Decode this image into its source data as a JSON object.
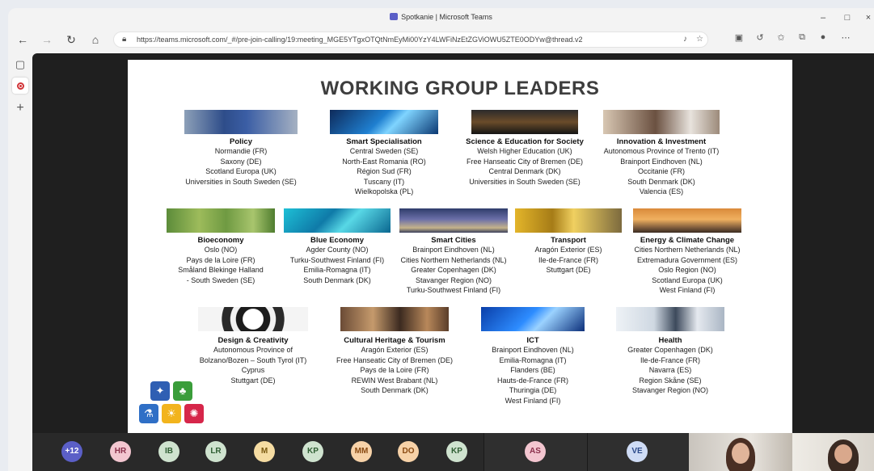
{
  "window": {
    "title": "Spotkanie | Microsoft Teams",
    "controls": {
      "minimize": "–",
      "maximize": "□",
      "close": "×"
    }
  },
  "browser": {
    "url": "https://teams.microsoft.com/_#/pre-join-calling/19:meeting_MGE5YTgxOTQtNmEyMi00YzY4LWFiNzEtZGViOWU5ZTE0ODYw@thread.v2",
    "icons": [
      "back-icon",
      "forward-icon",
      "refresh-icon",
      "home-icon",
      "lock-icon",
      "mic-icon",
      "favorite-icon",
      "extension-icon",
      "refresh-page-icon",
      "favorites-icon",
      "collections-icon",
      "profile-icon",
      "more-icon"
    ]
  },
  "slide": {
    "title": "WORKING GROUP LEADERS",
    "groups": [
      {
        "name": "Policy",
        "members": [
          "Normandie (FR)",
          "Saxony (DE)",
          "Scotland Europa (UK)",
          "Universities in South Sweden (SE)"
        ]
      },
      {
        "name": "Smart Specialisation",
        "members": [
          "Central Sweden (SE)",
          "North-East Romania (RO)",
          "Région Sud (FR)",
          "Tuscany (IT)",
          "Wielkopolska (PL)"
        ]
      },
      {
        "name": "Science & Education for Society",
        "members": [
          "Welsh Higher Education (UK)",
          "Free Hanseatic City of Bremen (DE)",
          "Central Denmark (DK)",
          "Universities in South Sweden (SE)"
        ]
      },
      {
        "name": "Innovation & Investment",
        "members": [
          "Autonomous Province of Trento (IT)",
          "Brainport Eindhoven (NL)",
          "Occitanie (FR)",
          "South Denmark (DK)",
          "Valencia (ES)"
        ]
      },
      {
        "name": "Bioeconomy",
        "members": [
          "Oslo (NO)",
          "Pays de la Loire (FR)",
          "Småland Blekinge Halland",
          "- South Sweden (SE)"
        ]
      },
      {
        "name": "Blue Economy",
        "members": [
          "Agder County (NO)",
          "Turku-Southwest Finland (FI)",
          "Emilia-Romagna (IT)",
          "South Denmark (DK)"
        ]
      },
      {
        "name": "Smart Cities",
        "members": [
          "Brainport Eindhoven (NL)",
          "Cities Northern Netherlands (NL)",
          "Greater Copenhagen (DK)",
          "Stavanger Region (NO)",
          "Turku-Southwest Finland (FI)"
        ]
      },
      {
        "name": "Transport",
        "members": [
          "Aragón Exterior (ES)",
          "Ile-de-France (FR)",
          "Stuttgart (DE)"
        ]
      },
      {
        "name": "Energy & Climate Change",
        "members": [
          "Cities Northern Netherlands (NL)",
          "Extremadura Government (ES)",
          "Oslo Region (NO)",
          "Scotland Europa (UK)",
          "West Finland (FI)"
        ]
      },
      {
        "name": "Design & Creativity",
        "members": [
          "Autonomous Province of",
          "Bolzano/Bozen – South Tyrol (IT)",
          "Cyprus",
          "Stuttgart (DE)"
        ]
      },
      {
        "name": "Cultural Heritage & Tourism",
        "members": [
          "Aragón Exterior (ES)",
          "Free Hanseatic City of Bremen (DE)",
          "Pays de la Loire (FR)",
          "REWIN West Brabant (NL)",
          "South Denmark (DK)"
        ]
      },
      {
        "name": "ICT",
        "members": [
          "Brainport Eindhoven (NL)",
          "Emilia-Romagna (IT)",
          "Flanders (BE)",
          "Hauts-de-France (FR)",
          "Thuringia (DE)",
          "West Finland (FI)"
        ]
      },
      {
        "name": "Health",
        "members": [
          "Greater Copenhagen (DK)",
          "Ile-de-France (FR)",
          "Navarra (ES)",
          "Region Skåne (SE)",
          "Stavanger Region (NO)"
        ]
      }
    ]
  },
  "participants": {
    "overflow": "+12",
    "avatars": [
      {
        "initials": "HR",
        "bg": "#f3c6d0",
        "fg": "#8a2f4a"
      },
      {
        "initials": "IB",
        "bg": "#cfe3cf",
        "fg": "#2f5e33"
      },
      {
        "initials": "LR",
        "bg": "#cfe3cf",
        "fg": "#2f5e33"
      },
      {
        "initials": "M",
        "bg": "#f5dca2",
        "fg": "#7a5a10"
      },
      {
        "initials": "KP",
        "bg": "#cfe3cf",
        "fg": "#2f5e33"
      },
      {
        "initials": "MM",
        "bg": "#f7d2a8",
        "fg": "#8a4a12"
      },
      {
        "initials": "DO",
        "bg": "#f7d2a8",
        "fg": "#8a4a12"
      },
      {
        "initials": "KP",
        "bg": "#cfe3cf",
        "fg": "#2f5e33"
      },
      {
        "initials": "AS",
        "bg": "#f3c6d0",
        "fg": "#8a2f4a"
      },
      {
        "initials": "VE",
        "bg": "#cfdcf5",
        "fg": "#2d4b8a"
      }
    ]
  }
}
